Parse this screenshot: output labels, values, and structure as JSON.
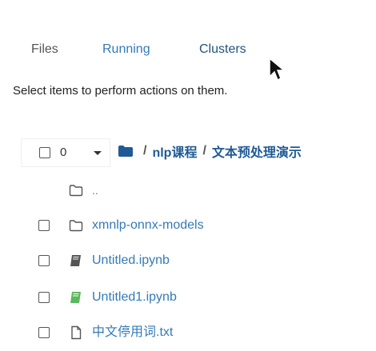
{
  "tabs": [
    {
      "label": "Files"
    },
    {
      "label": "Running"
    },
    {
      "label": "Clusters"
    }
  ],
  "select_note": "Select items to perform actions on them.",
  "selector": {
    "count": "0"
  },
  "breadcrumb": {
    "items": [
      {
        "label": "nlp课程"
      },
      {
        "label": "文本预处理演示"
      }
    ],
    "separator": "/"
  },
  "files": [
    {
      "name": "..",
      "icon": "folder-icon",
      "color": "#777777"
    },
    {
      "name": "xmnlp-onnx-models",
      "icon": "folder-icon",
      "color": "#337ab7"
    },
    {
      "name": "Untitled.ipynb",
      "icon": "notebook-icon",
      "icon_color": "#555555",
      "color": "#337ab7"
    },
    {
      "name": "Untitled1.ipynb",
      "icon": "notebook-running-icon",
      "icon_color": "#5cb85c",
      "color": "#337ab7"
    },
    {
      "name": "中文停用词.txt",
      "icon": "file-icon",
      "color": "#337ab7"
    }
  ],
  "colors": {
    "link": "#337ab7",
    "breadcrumb": "#1f5a96",
    "running_notebook": "#5cb85c"
  }
}
